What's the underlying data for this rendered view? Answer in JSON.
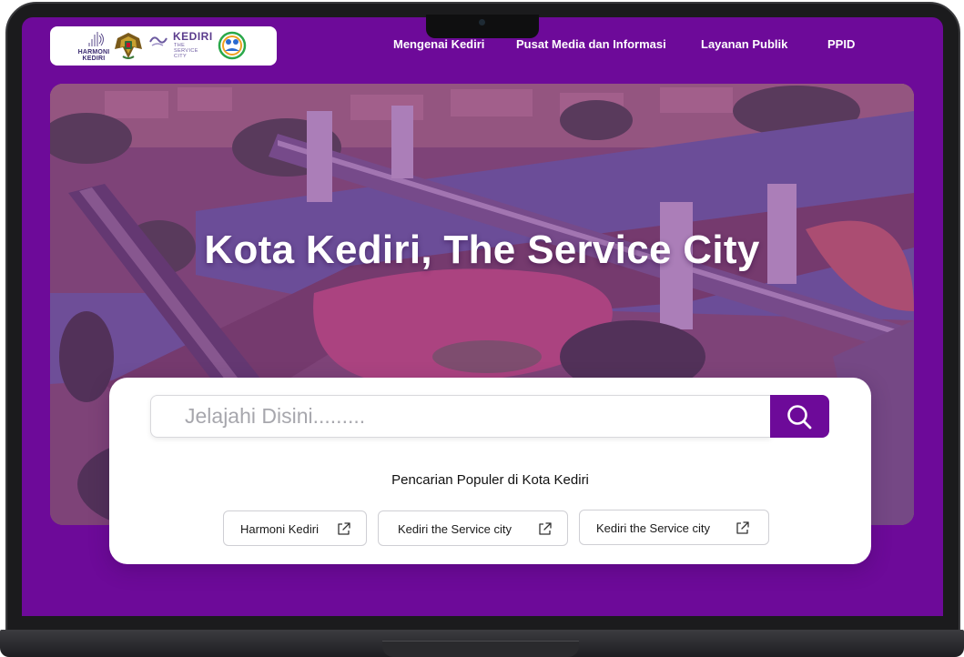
{
  "nav": {
    "items": [
      "Mengenai Kediri",
      "Pusat Media dan Informasi",
      "Layanan Publik",
      "PPID"
    ]
  },
  "logos": {
    "harmoni_text": "HARMONI\nKEDIRI",
    "kediri_word": "KEDIRI",
    "kediri_tagline": "THE\nSERVICE\nCITY"
  },
  "hero": {
    "title": "Kota Kediri, The Service City"
  },
  "search": {
    "placeholder": "Jelajahi Disini.........",
    "popular_heading": "Pencarian Populer di Kota Kediri",
    "chips": [
      "Harmoni Kediri",
      "Kediri the Service city",
      "Kediri the Service city"
    ]
  },
  "icons": {
    "search_button": "search-icon",
    "chip": "external-link-icon"
  },
  "colors": {
    "brand_purple": "#6d0a99",
    "card_background": "#ffffff"
  }
}
